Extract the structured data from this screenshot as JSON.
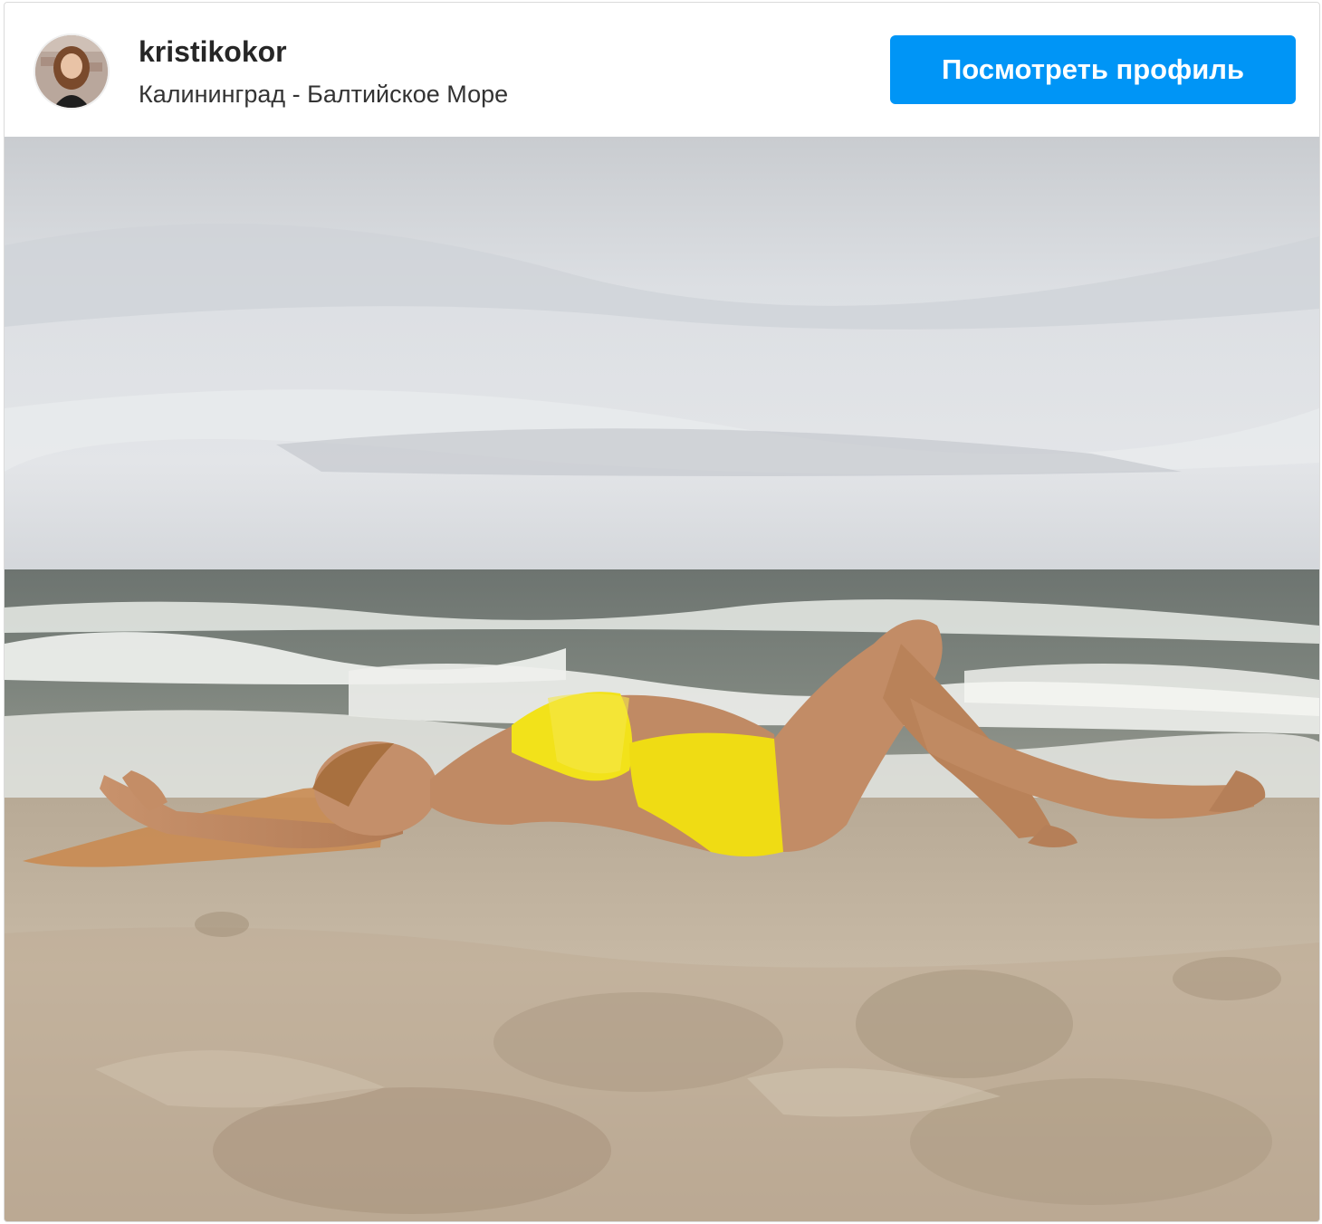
{
  "post": {
    "username": "kristikokor",
    "location": "Калининград - Балтийское Море",
    "view_profile_label": "Посмотреть профиль"
  },
  "colors": {
    "button_background": "#0095f6",
    "button_text": "#ffffff",
    "username_text": "#262626",
    "location_text": "#333333",
    "swimsuit": "#f2e21a"
  },
  "icons": {
    "avatar": "profile-photo-avatar"
  }
}
